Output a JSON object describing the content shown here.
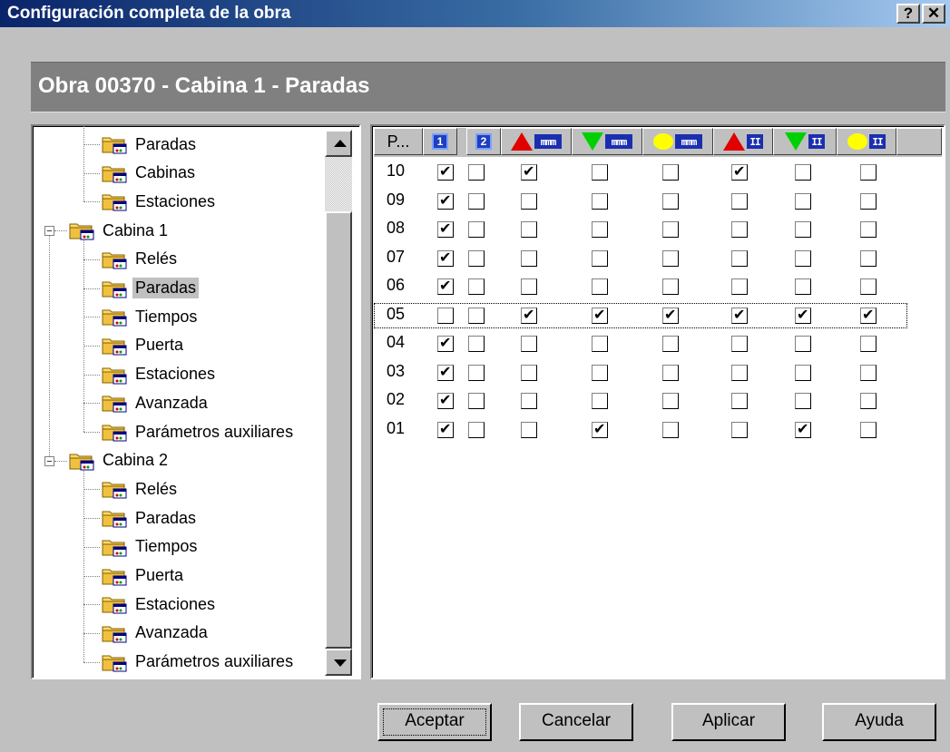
{
  "window": {
    "title": "Configuración completa de la obra",
    "help_label": "?",
    "close_label": "✕"
  },
  "header": {
    "title": "Obra 00370 - Cabina 1 - Paradas"
  },
  "tree": {
    "items": [
      {
        "label": "Paradas",
        "level": 2
      },
      {
        "label": "Cabinas",
        "level": 2
      },
      {
        "label": "Estaciones",
        "level": 2
      },
      {
        "label": "Cabina 1",
        "level": 1,
        "expander": "−"
      },
      {
        "label": "Relés",
        "level": 2
      },
      {
        "label": "Paradas",
        "level": 2,
        "selected": true
      },
      {
        "label": "Tiempos",
        "level": 2
      },
      {
        "label": "Puerta",
        "level": 2
      },
      {
        "label": "Estaciones",
        "level": 2
      },
      {
        "label": "Avanzada",
        "level": 2
      },
      {
        "label": "Parámetros auxiliares",
        "level": 2
      },
      {
        "label": "Cabina 2",
        "level": 1,
        "expander": "−"
      },
      {
        "label": "Relés",
        "level": 2
      },
      {
        "label": "Paradas",
        "level": 2
      },
      {
        "label": "Tiempos",
        "level": 2
      },
      {
        "label": "Puerta",
        "level": 2
      },
      {
        "label": "Estaciones",
        "level": 2
      },
      {
        "label": "Avanzada",
        "level": 2
      },
      {
        "label": "Parámetros auxiliares",
        "level": 2
      }
    ]
  },
  "grid": {
    "first_col_label": "P...",
    "columns": [
      {
        "icon": "num-1-icon",
        "text": "1"
      },
      {
        "icon": "num-2-icon",
        "text": "2"
      },
      {
        "icon": "red-up-triangle-icon",
        "badge": "mmm"
      },
      {
        "icon": "green-down-triangle-icon",
        "badge": "mmm"
      },
      {
        "icon": "yellow-circle-icon",
        "badge": "mmm"
      },
      {
        "icon": "red-up-triangle-icon",
        "badge": "II"
      },
      {
        "icon": "green-down-triangle-icon",
        "badge": "II"
      },
      {
        "icon": "yellow-circle-icon",
        "badge": "II"
      }
    ],
    "colors": {
      "red": "#e00000",
      "green": "#00d000",
      "yellow": "#ffff00",
      "blue": "#1a2fb0"
    },
    "focused_row": "05",
    "rows": [
      {
        "label": "10",
        "checks": [
          true,
          false,
          true,
          false,
          false,
          true,
          false,
          false
        ]
      },
      {
        "label": "09",
        "checks": [
          true,
          false,
          false,
          false,
          false,
          false,
          false,
          false
        ]
      },
      {
        "label": "08",
        "checks": [
          true,
          false,
          false,
          false,
          false,
          false,
          false,
          false
        ]
      },
      {
        "label": "07",
        "checks": [
          true,
          false,
          false,
          false,
          false,
          false,
          false,
          false
        ]
      },
      {
        "label": "06",
        "checks": [
          true,
          false,
          false,
          false,
          false,
          false,
          false,
          false
        ]
      },
      {
        "label": "05",
        "checks": [
          false,
          false,
          true,
          true,
          true,
          true,
          true,
          true
        ]
      },
      {
        "label": "04",
        "checks": [
          true,
          false,
          false,
          false,
          false,
          false,
          false,
          false
        ]
      },
      {
        "label": "03",
        "checks": [
          true,
          false,
          false,
          false,
          false,
          false,
          false,
          false
        ]
      },
      {
        "label": "02",
        "checks": [
          true,
          false,
          false,
          false,
          false,
          false,
          false,
          false
        ]
      },
      {
        "label": "01",
        "checks": [
          true,
          false,
          false,
          true,
          false,
          false,
          true,
          false
        ]
      }
    ]
  },
  "buttons": {
    "accept": "Aceptar",
    "cancel": "Cancelar",
    "apply": "Aplicar",
    "help": "Ayuda"
  }
}
